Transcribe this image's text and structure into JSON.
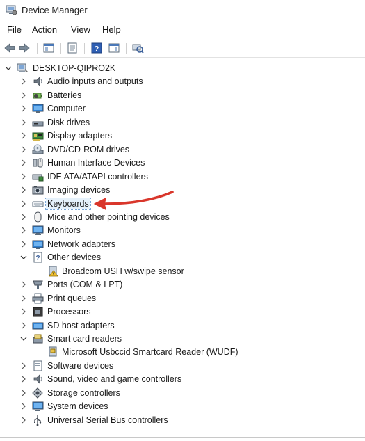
{
  "window": {
    "title": "Device Manager"
  },
  "menu": [
    "File",
    "Action",
    "View",
    "Help"
  ],
  "toolbar": {
    "buttons": [
      "back-icon",
      "forward-icon",
      "show-hide-console-tree-icon",
      "properties-icon",
      "help-icon",
      "view-icon",
      "scan-hardware-icon"
    ]
  },
  "tree": {
    "root": "DESKTOP-QIPRO2K",
    "categories": [
      {
        "label": "Audio inputs and outputs",
        "expanded": false,
        "icon": "speaker-icon"
      },
      {
        "label": "Batteries",
        "expanded": false,
        "icon": "battery-icon"
      },
      {
        "label": "Computer",
        "expanded": false,
        "icon": "monitor-icon"
      },
      {
        "label": "Disk drives",
        "expanded": false,
        "icon": "disk-drive-icon"
      },
      {
        "label": "Display adapters",
        "expanded": false,
        "icon": "display-adapter-icon"
      },
      {
        "label": "DVD/CD-ROM drives",
        "expanded": false,
        "icon": "dvd-drive-icon"
      },
      {
        "label": "Human Interface Devices",
        "expanded": false,
        "icon": "hid-icon"
      },
      {
        "label": "IDE ATA/ATAPI controllers",
        "expanded": false,
        "icon": "ide-controller-icon"
      },
      {
        "label": "Imaging devices",
        "expanded": false,
        "icon": "camera-icon"
      },
      {
        "label": "Keyboards",
        "expanded": false,
        "icon": "keyboard-icon",
        "selected": true
      },
      {
        "label": "Mice and other pointing devices",
        "expanded": false,
        "icon": "mouse-icon"
      },
      {
        "label": "Monitors",
        "expanded": false,
        "icon": "monitor-icon"
      },
      {
        "label": "Network adapters",
        "expanded": false,
        "icon": "network-adapter-icon"
      },
      {
        "label": "Other devices",
        "expanded": true,
        "icon": "unknown-device-icon",
        "children": [
          {
            "label": "Broadcom USH w/swipe sensor",
            "icon": "warning-device-icon"
          }
        ]
      },
      {
        "label": "Ports (COM & LPT)",
        "expanded": false,
        "icon": "port-icon"
      },
      {
        "label": "Print queues",
        "expanded": false,
        "icon": "printer-icon"
      },
      {
        "label": "Processors",
        "expanded": false,
        "icon": "processor-icon"
      },
      {
        "label": "SD host adapters",
        "expanded": false,
        "icon": "sd-card-icon"
      },
      {
        "label": "Smart card readers",
        "expanded": true,
        "icon": "smart-card-reader-icon",
        "children": [
          {
            "label": "Microsoft Usbccid Smartcard Reader (WUDF)",
            "icon": "smart-card-device-icon"
          }
        ]
      },
      {
        "label": "Software devices",
        "expanded": false,
        "icon": "software-device-icon"
      },
      {
        "label": "Sound, video and game controllers",
        "expanded": false,
        "icon": "speaker-icon"
      },
      {
        "label": "Storage controllers",
        "expanded": false,
        "icon": "storage-controller-icon"
      },
      {
        "label": "System devices",
        "expanded": false,
        "icon": "system-device-icon"
      },
      {
        "label": "Universal Serial Bus controllers",
        "expanded": false,
        "icon": "usb-icon"
      }
    ]
  },
  "annotation": {
    "icon": "red-arrow-icon",
    "color": "#d9362b",
    "points_to": "Keyboards"
  },
  "colors": {
    "selection": "#e5f1fb",
    "arrow": "#d9362b"
  }
}
